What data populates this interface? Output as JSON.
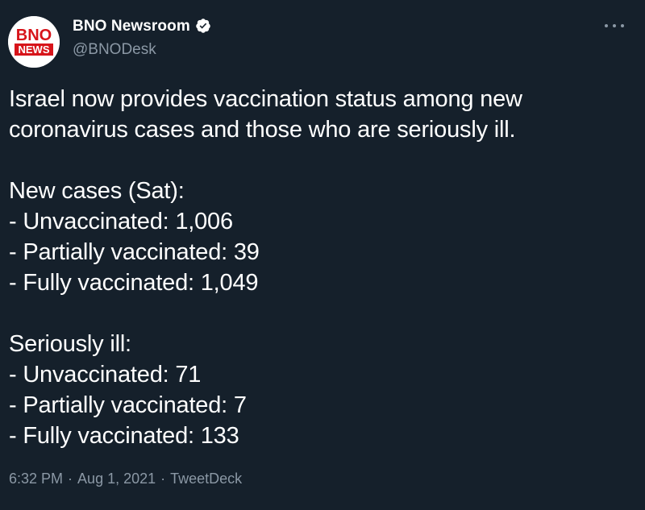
{
  "author": {
    "display_name": "BNO Newsroom",
    "handle": "@BNODesk",
    "verified": true,
    "avatar": {
      "line1": "BNO",
      "line2": "NEWS",
      "accent": "#d7141a"
    }
  },
  "tweet": {
    "headline_line1": "Israel now provides vaccination status among new",
    "headline_line2": "coronavirus cases and those who are seriously ill.",
    "new_cases": {
      "heading": "New cases (Sat):",
      "items": [
        "- Unvaccinated: 1,006",
        "- Partially vaccinated: 39",
        "- Fully vaccinated: 1,049"
      ]
    },
    "seriously_ill": {
      "heading": "Seriously ill:",
      "items": [
        "- Unvaccinated: 71",
        "- Partially vaccinated: 7",
        "- Fully vaccinated: 133"
      ]
    }
  },
  "meta": {
    "time": "6:32 PM",
    "separator": "·",
    "date": "Aug 1, 2021",
    "source": "TweetDeck"
  },
  "colors": {
    "background": "#15202b",
    "text": "#ffffff",
    "secondary_text": "#8b98a5",
    "brand_red": "#d7141a"
  },
  "icons": {
    "verified": "verified-badge-icon",
    "more": "more-options-icon"
  }
}
